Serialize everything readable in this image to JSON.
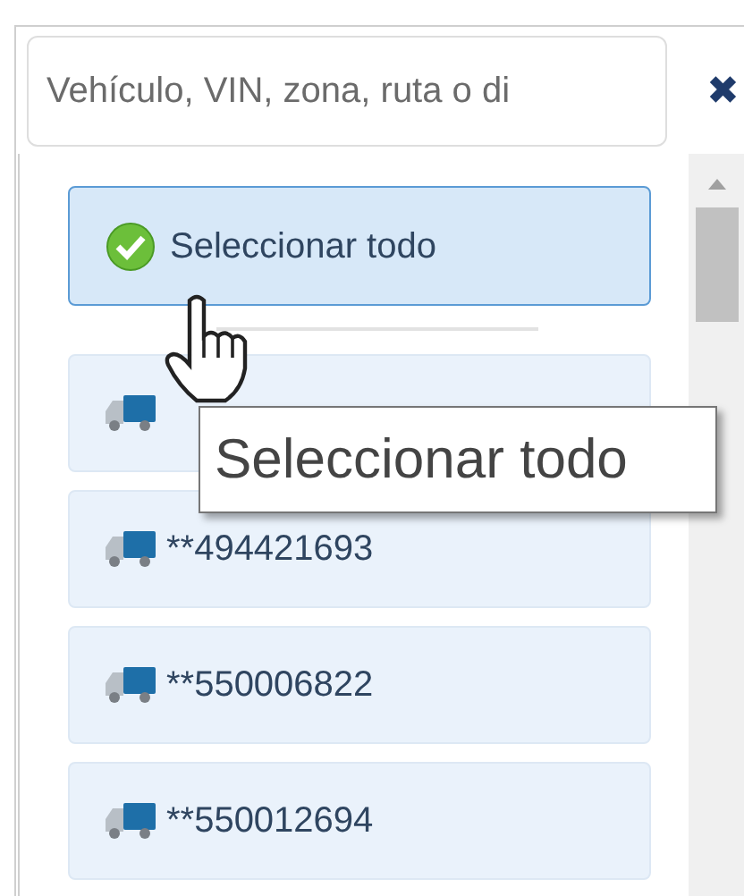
{
  "search": {
    "placeholder": "Vehículo, VIN, zona, ruta o di"
  },
  "clear_button": {
    "label": "✖"
  },
  "select_all": {
    "label": "Seleccionar todo",
    "checked": true,
    "highlighted": true
  },
  "vehicles": [
    {
      "selected": false
    },
    {
      "label": "**494421693",
      "selected": false
    },
    {
      "label": "**550006822",
      "selected": false
    },
    {
      "label": "**550012694",
      "selected": false
    }
  ],
  "tooltip": {
    "text": "Seleccionar todo"
  }
}
